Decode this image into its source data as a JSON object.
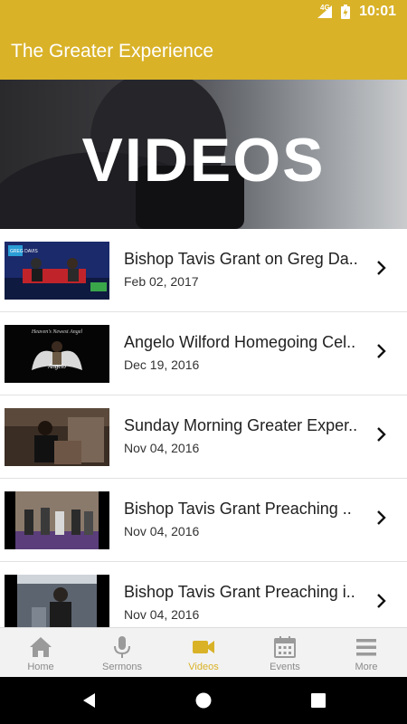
{
  "status": {
    "time": "10:01",
    "network": "4G"
  },
  "appbar": {
    "title": "The Greater Experience"
  },
  "hero": {
    "title": "VIDEOS"
  },
  "videos": [
    {
      "title": "Bishop Tavis Grant on Greg Da..",
      "date": "Feb 02, 2017",
      "thumb_text": "GREG DAVIS"
    },
    {
      "title": "Angelo Wilford Homegoing Cel..",
      "date": "Dec 19, 2016",
      "thumb_text": "Heaven's Newest Angel",
      "thumb_sub": "Angelo"
    },
    {
      "title": "Sunday Morning Greater Exper..",
      "date": "Nov 04, 2016"
    },
    {
      "title": "Bishop Tavis Grant Preaching ..",
      "date": "Nov 04, 2016"
    },
    {
      "title": "Bishop Tavis Grant Preaching i..",
      "date": "Nov 04, 2016"
    }
  ],
  "bottom_nav": [
    {
      "label": "Home",
      "icon": "home-icon"
    },
    {
      "label": "Sermons",
      "icon": "microphone-icon"
    },
    {
      "label": "Videos",
      "icon": "video-camera-icon",
      "active": true
    },
    {
      "label": "Events",
      "icon": "calendar-icon"
    },
    {
      "label": "More",
      "icon": "menu-icon"
    }
  ],
  "colors": {
    "accent": "#d9b228",
    "nav_inactive": "#8a8a8a"
  }
}
